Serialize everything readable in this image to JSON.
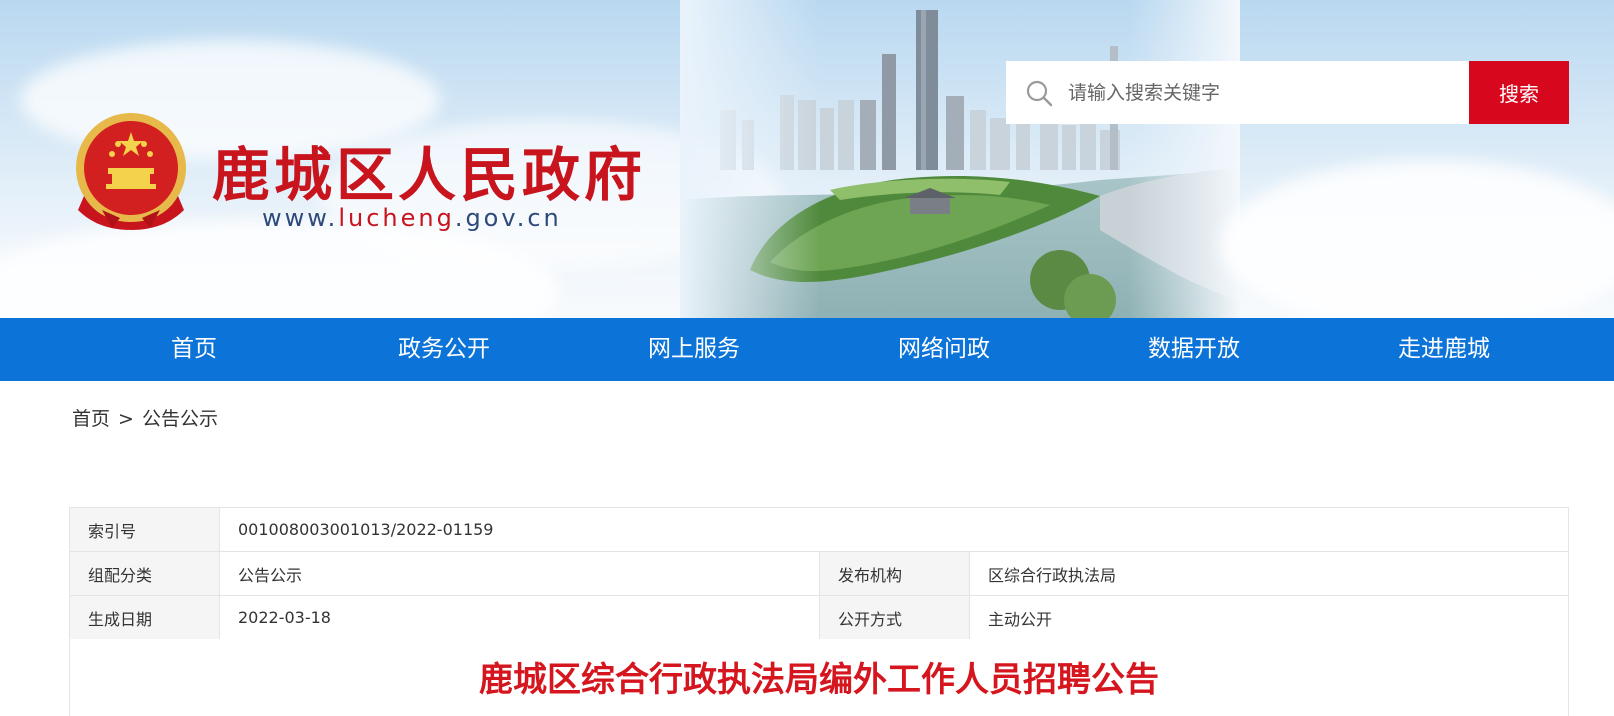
{
  "header": {
    "site_title": "鹿城区人民政府",
    "url_prefix": "www.",
    "url_highlight": "lucheng",
    "url_suffix": ".gov.cn"
  },
  "search": {
    "placeholder": "请输入搜索关键字",
    "value": "",
    "button_label": "搜索"
  },
  "nav": {
    "items": [
      {
        "label": "首页"
      },
      {
        "label": "政务公开"
      },
      {
        "label": "网上服务"
      },
      {
        "label": "网络问政"
      },
      {
        "label": "数据开放"
      },
      {
        "label": "走进鹿城"
      }
    ]
  },
  "breadcrumb": {
    "home": "首页",
    "separator": ">",
    "current": "公告公示"
  },
  "info": {
    "index_label": "索引号",
    "index_value": "001008003001013/2022-01159",
    "category_label": "组配分类",
    "category_value": "公告公示",
    "publisher_label": "发布机构",
    "publisher_value": "区综合行政执法局",
    "date_label": "生成日期",
    "date_value": "2022-03-18",
    "disclosure_label": "公开方式",
    "disclosure_value": "主动公开"
  },
  "article": {
    "title": "鹿城区综合行政执法局编外工作人员招聘公告"
  },
  "colors": {
    "nav_blue": "#0c74d8",
    "brand_red": "#c8151d",
    "search_red": "#d7081e"
  }
}
